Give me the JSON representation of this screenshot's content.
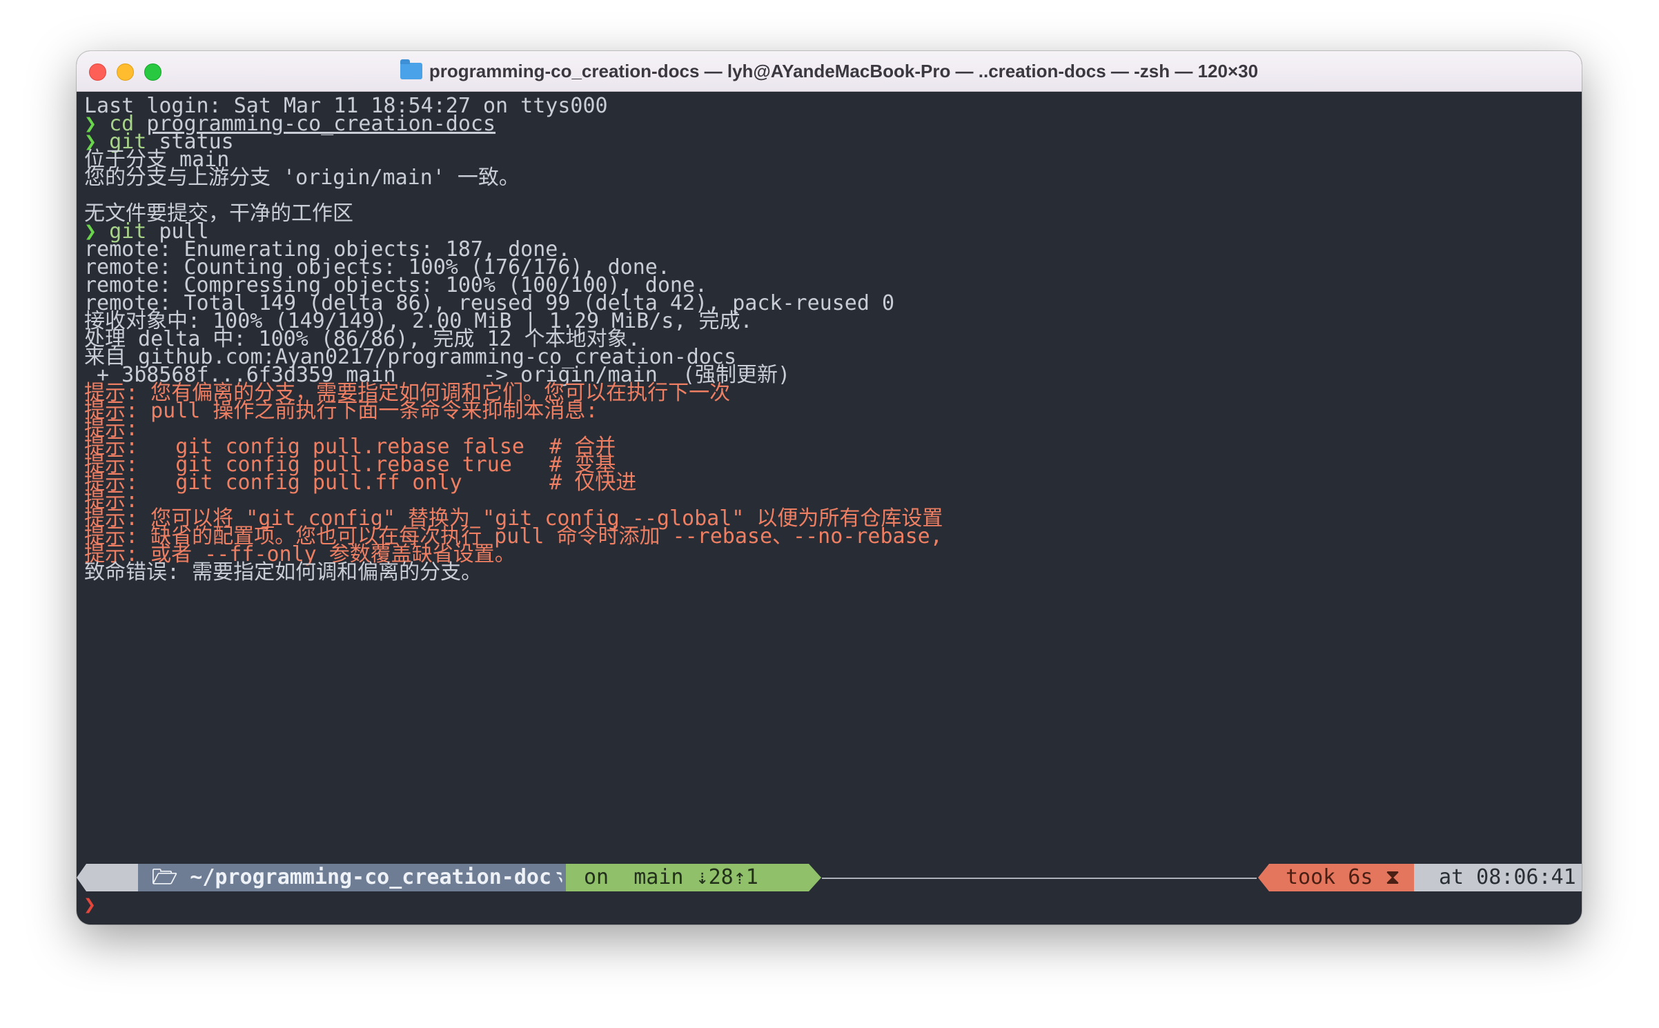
{
  "window": {
    "title": "programming-co_creation-docs — lyh@AYandeMacBook-Pro — ..creation-docs — -zsh — 120×30"
  },
  "terminal": {
    "prompt_symbol": "❯",
    "lines": {
      "l00": "Last login: Sat Mar 11 18:54:27 on ttys000",
      "l01_cmd": "cd",
      "l01_arg": "programming-co_creation-docs",
      "l02_cmd": "git",
      "l02_arg": " status",
      "l03": "位于分支 main",
      "l04": "您的分支与上游分支 'origin/main' 一致。",
      "l06": "无文件要提交，干净的工作区",
      "l07_cmd": "git",
      "l07_arg": " pull",
      "l08": "remote: Enumerating objects: 187, done.",
      "l09": "remote: Counting objects: 100% (176/176), done.",
      "l10": "remote: Compressing objects: 100% (100/100), done.",
      "l11": "remote: Total 149 (delta 86), reused 99 (delta 42), pack-reused 0",
      "l12": "接收对象中: 100% (149/149), 2.00 MiB | 1.29 MiB/s, 完成.",
      "l13": "处理 delta 中: 100% (86/86), 完成 12 个本地对象.",
      "l14": "来自 github.com:Ayan0217/programming-co_creation-docs",
      "l15": " + 3b8568f...6f3d359 main       -> origin/main  (强制更新)",
      "l16": "提示: 您有偏离的分支，需要指定如何调和它们。您可以在执行下一次",
      "l17": "提示: pull 操作之前执行下面一条命令来抑制本消息:",
      "l18": "提示:",
      "l19": "提示:   git config pull.rebase false  # 合并",
      "l20": "提示:   git config pull.rebase true   # 变基",
      "l21": "提示:   git config pull.ff only       # 仅快进",
      "l22": "提示:",
      "l23": "提示: 您可以将 \"git config\" 替换为 \"git config --global\" 以便为所有仓库设置",
      "l24": "提示: 缺省的配置项。您也可以在每次执行 pull 命令时添加 --rebase、--no-rebase,",
      "l25": "提示: 或者 --ff-only 参数覆盖缺省设置。",
      "l26": "致命错误: 需要指定如何调和偏离的分支。"
    }
  },
  "statusbar": {
    "apple": "",
    "path": "🗁 ~/programming-co_creation-docs",
    "git": "on  main ⇣28⇡1",
    "took": "took 6s ⧗",
    "time": "at 08:06:41 ⊙"
  },
  "colors": {
    "background": "#272c35",
    "text": "#c8cdd6",
    "hint": "#ee7f63",
    "prompt": "#6bd44d",
    "final_prompt": "#e3463b"
  }
}
